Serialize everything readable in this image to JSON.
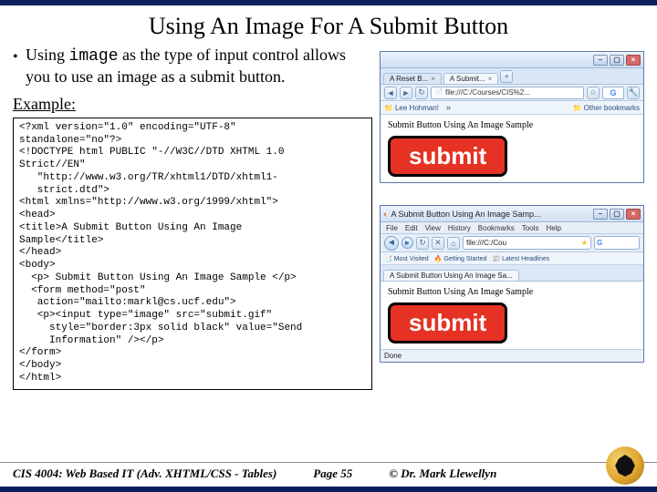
{
  "title": "Using An Image For A Submit Button",
  "bullet": {
    "prefix": "Using ",
    "mono": "image",
    "rest": " as the type of input control allows you to use an image as a submit button."
  },
  "example_label": "Example:",
  "code": "<?xml version=\"1.0\" encoding=\"UTF-8\"\nstandalone=\"no\"?>\n<!DOCTYPE html PUBLIC \"-//W3C//DTD XHTML 1.0\nStrict//EN\"\n   \"http://www.w3.org/TR/xhtml1/DTD/xhtml1-\n   strict.dtd\">\n<html xmlns=\"http://www.w3.org/1999/xhtml\">\n<head>\n<title>A Submit Button Using An Image\nSample</title>\n</head>\n<body>\n  <p> Submit Button Using An Image Sample </p>\n  <form method=\"post\"\n   action=\"mailto:markl@cs.ucf.edu\">\n   <p><input type=\"image\" src=\"submit.gif\"\n     style=\"border:3px solid black\" value=\"Send\n     Information\" /></p>\n</form>\n</body>\n</html>",
  "chrome": {
    "tab1": "A Reset B...",
    "tab2": "A Submit...",
    "url": "file:///C:/Courses/CIS%2...",
    "bookmark1": "Lee Hohman!",
    "other_bookmarks": "Other bookmarks",
    "page_text": "Submit Button Using An Image Sample",
    "submit": "submit"
  },
  "firefox": {
    "wintitle": "A Submit Button Using An Image Samp...",
    "menus": [
      "File",
      "Edit",
      "View",
      "History",
      "Bookmarks",
      "Tools",
      "Help"
    ],
    "url": "file:///C:/Cou",
    "bk_most": "Most Visited",
    "bk_get": "Getting Started",
    "bk_latest": "Latest Headlines",
    "tab": "A Submit Button Using An Image Sa...",
    "page_text": "Submit Button Using An Image Sample",
    "submit": "submit",
    "status": "Done"
  },
  "footer": {
    "course": "CIS 4004: Web Based IT (Adv. XHTML/CSS - Tables)",
    "page": "Page 55",
    "copyright": "© Dr. Mark Llewellyn"
  }
}
